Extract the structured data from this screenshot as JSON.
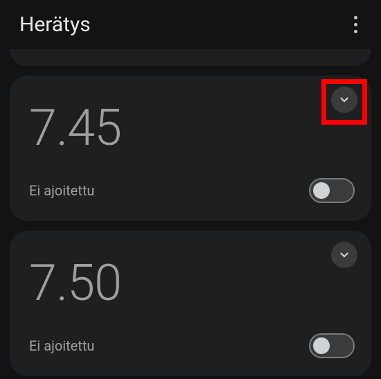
{
  "header": {
    "title": "Herätys"
  },
  "alarms": [
    {
      "time": "7.45",
      "status": "Ei ajoitettu",
      "enabled": false,
      "highlighted": true
    },
    {
      "time": "7.50",
      "status": "Ei ajoitettu",
      "enabled": false,
      "highlighted": false
    }
  ]
}
